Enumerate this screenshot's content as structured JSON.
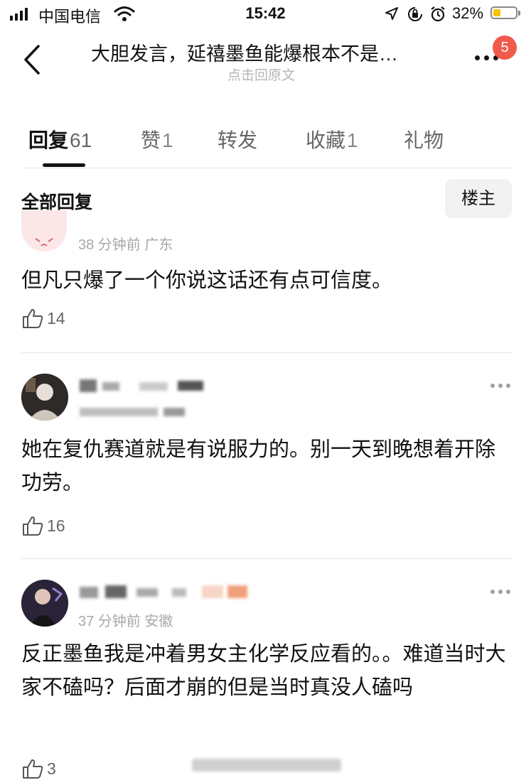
{
  "status_bar": {
    "carrier": "中国电信",
    "time": "15:42",
    "battery": "32%",
    "battery_level": 0.32
  },
  "nav": {
    "title": "大胆发言，延禧墨鱼能爆根本不是…",
    "subtitle": "点击回原文",
    "notification_count": "5"
  },
  "tabs": [
    {
      "label": "回复",
      "count": "61",
      "active": true
    },
    {
      "label": "赞",
      "count": "1",
      "active": false
    },
    {
      "label": "转发",
      "count": "",
      "active": false
    },
    {
      "label": "收藏",
      "count": "1",
      "active": false
    },
    {
      "label": "礼物",
      "count": "",
      "active": false
    }
  ],
  "section": {
    "title": "全部回复",
    "owner_filter": "楼主"
  },
  "comments": [
    {
      "meta": "38 分钟前  广东",
      "text": "但凡只爆了一个你说这话还有点可信度。",
      "likes": "14"
    },
    {
      "meta": "",
      "text": "她在复仇赛道就是有说服力的。别一天到晚想着开除功劳。",
      "likes": "16"
    },
    {
      "meta": "37 分钟前  安徽",
      "text": "反正墨鱼我是冲着男女主化学反应看的。。难道当时大家不磕吗？后面才崩的但是当时真没人磕吗",
      "likes": "3"
    }
  ],
  "colors": {
    "badge": "#f05a4a",
    "battery_fill": "#f5c400",
    "divider": "#e6e6e6"
  },
  "icons": [
    "signal-icon",
    "wifi-icon",
    "location-icon",
    "rotation-lock-icon",
    "alarm-icon",
    "battery-icon",
    "back-chevron-icon",
    "more-icon",
    "thumbs-up-icon"
  ]
}
